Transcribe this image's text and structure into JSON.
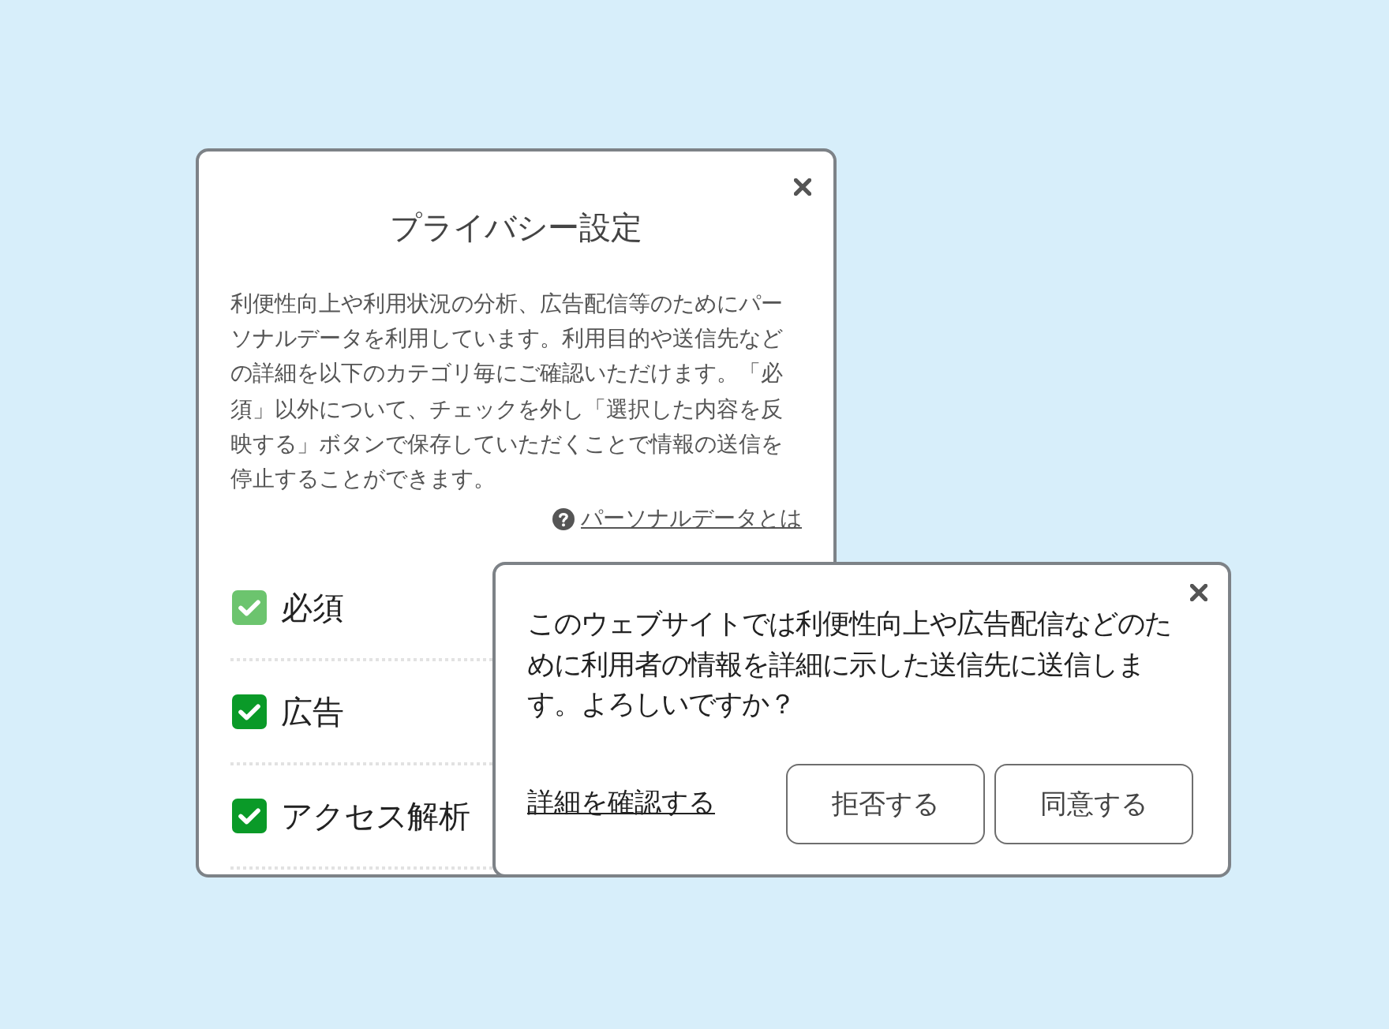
{
  "privacy_dialog": {
    "title": "プライバシー設定",
    "description": "利便性向上や利用状況の分析、広告配信等のためにパーソナルデータを利用しています。利用目的や送信先などの詳細を以下のカテゴリ毎にご確認いただけます。「必須」以外について、チェックを外し「選択した内容を反映する」ボタンで保存していただくことで情報の送信を停止することができます。",
    "link": "パーソナルデータとは",
    "categories": [
      {
        "label": "必須",
        "checked": true,
        "disabled": true
      },
      {
        "label": "広告",
        "checked": true,
        "disabled": false
      },
      {
        "label": "アクセス解析",
        "checked": true,
        "disabled": false
      }
    ]
  },
  "consent_banner": {
    "message": "このウェブサイトでは利便性向上や広告配信などのために利用者の情報を詳細に示した送信先に送信します。よろしいですか？",
    "details_link": "詳細を確認する",
    "buttons": [
      "拒否する",
      "同意する"
    ]
  }
}
